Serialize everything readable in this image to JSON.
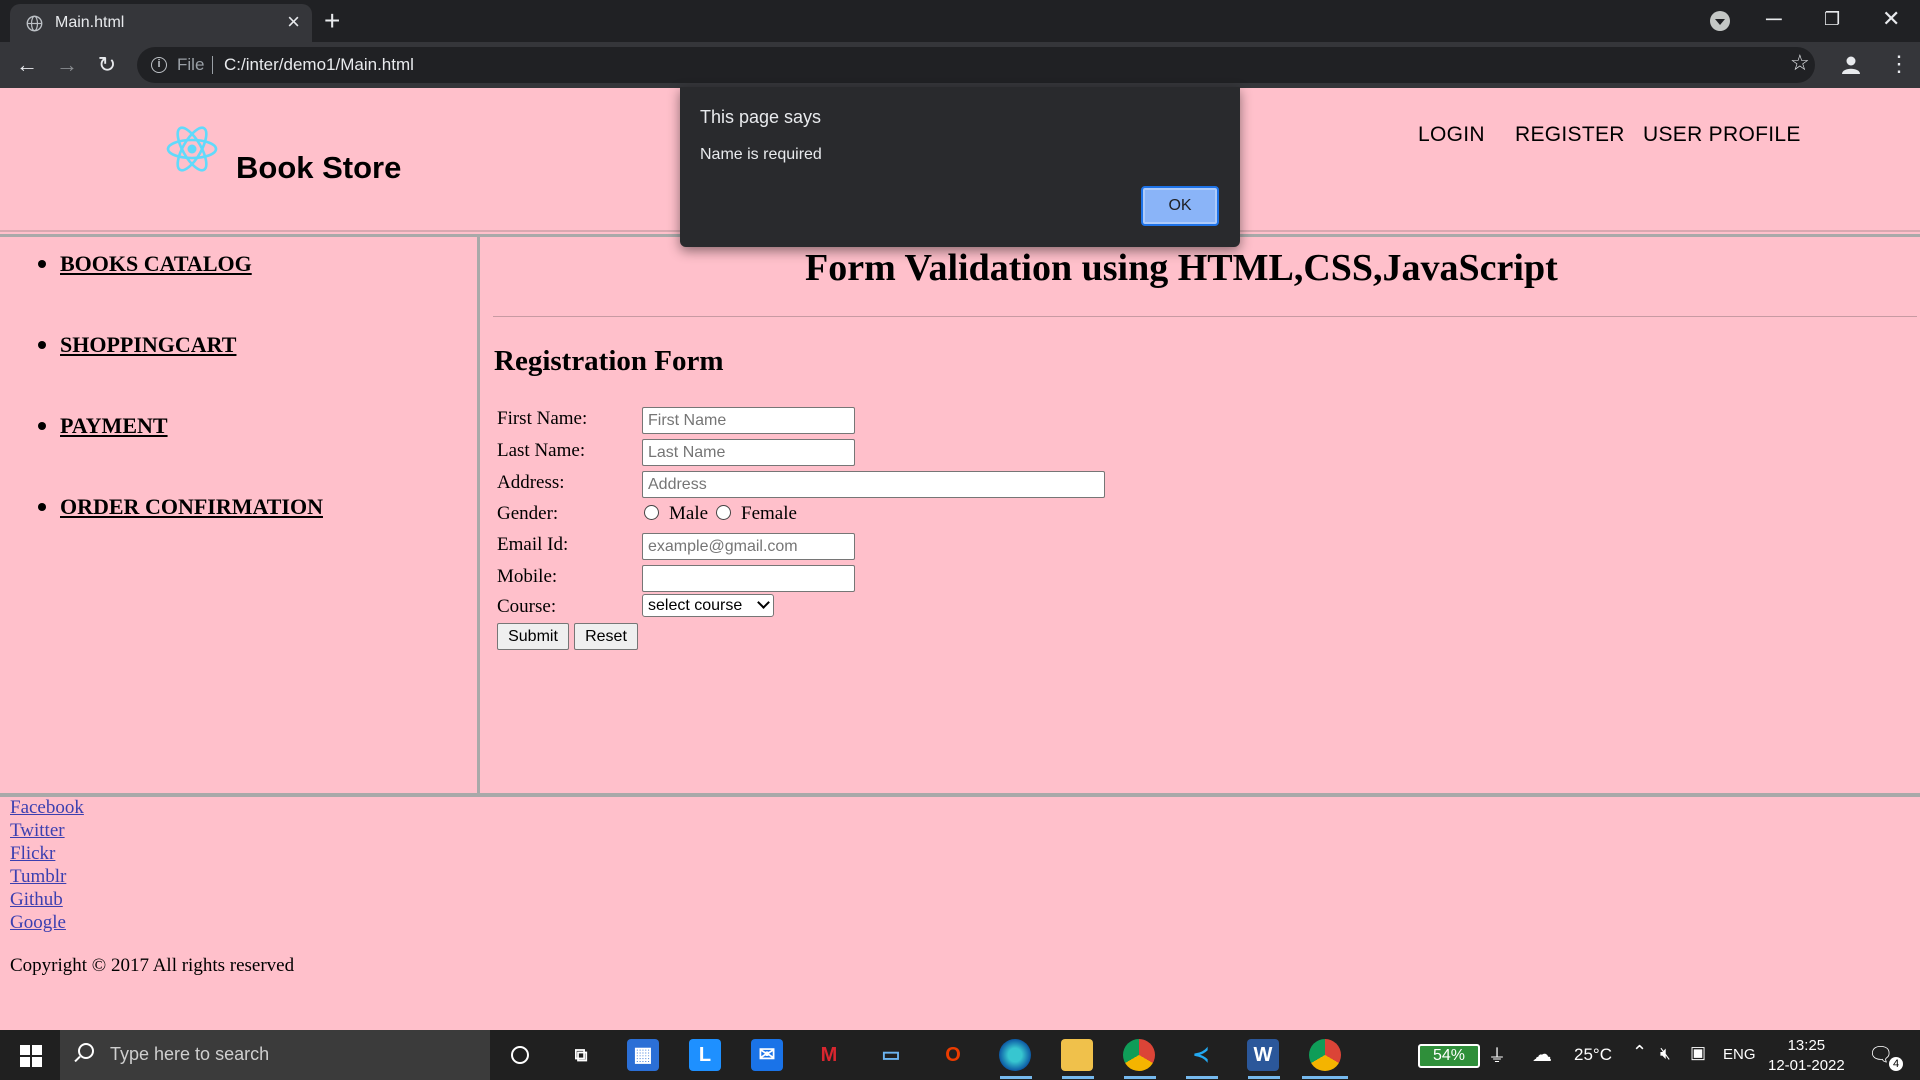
{
  "browser": {
    "tab_title": "Main.html",
    "address_scheme": "File",
    "address_url": "C:/inter/demo1/Main.html"
  },
  "header": {
    "brand": "Book Store",
    "nav": [
      {
        "label": "LOGIN"
      },
      {
        "label": "REGISTER"
      },
      {
        "label": "USER PROFILE"
      }
    ]
  },
  "sidebar": {
    "items": [
      {
        "label": "BOOKS CATALOG"
      },
      {
        "label": "SHOPPINGCART"
      },
      {
        "label": "PAYMENT"
      },
      {
        "label": "ORDER CONFIRMATION"
      }
    ]
  },
  "main": {
    "title": "Form Validation using HTML,CSS,JavaScript",
    "form_title": "Registration Form",
    "fields": {
      "first_name": {
        "label": "First Name:",
        "placeholder": "First Name"
      },
      "last_name": {
        "label": "Last Name:",
        "placeholder": "Last Name"
      },
      "address": {
        "label": "Address:",
        "placeholder": "Address"
      },
      "gender": {
        "label": "Gender:",
        "options": [
          "Male",
          "Female"
        ]
      },
      "email": {
        "label": "Email Id:",
        "placeholder": "example@gmail.com"
      },
      "mobile": {
        "label": "Mobile:",
        "placeholder": ""
      },
      "course": {
        "label": "Course:",
        "selected": "select course"
      }
    },
    "submit_label": "Submit",
    "reset_label": "Reset"
  },
  "footer": {
    "links": [
      "Facebook",
      "Twitter",
      "Flickr",
      "Tumblr",
      "Github",
      "Google"
    ],
    "copyright": "Copyright © 2017 All rights reserved"
  },
  "alert": {
    "title": "This page says",
    "message": "Name is required",
    "ok_label": "OK"
  },
  "taskbar": {
    "search_placeholder": "Type here to search",
    "battery": "54%",
    "temperature": "25°C",
    "language": "ENG",
    "time": "13:25",
    "date": "12-01-2022",
    "notifications": "4"
  },
  "colors": {
    "page_background": "#ffc0cb",
    "link": "#3b3fb0",
    "alert_button": "#8ab4f8"
  }
}
